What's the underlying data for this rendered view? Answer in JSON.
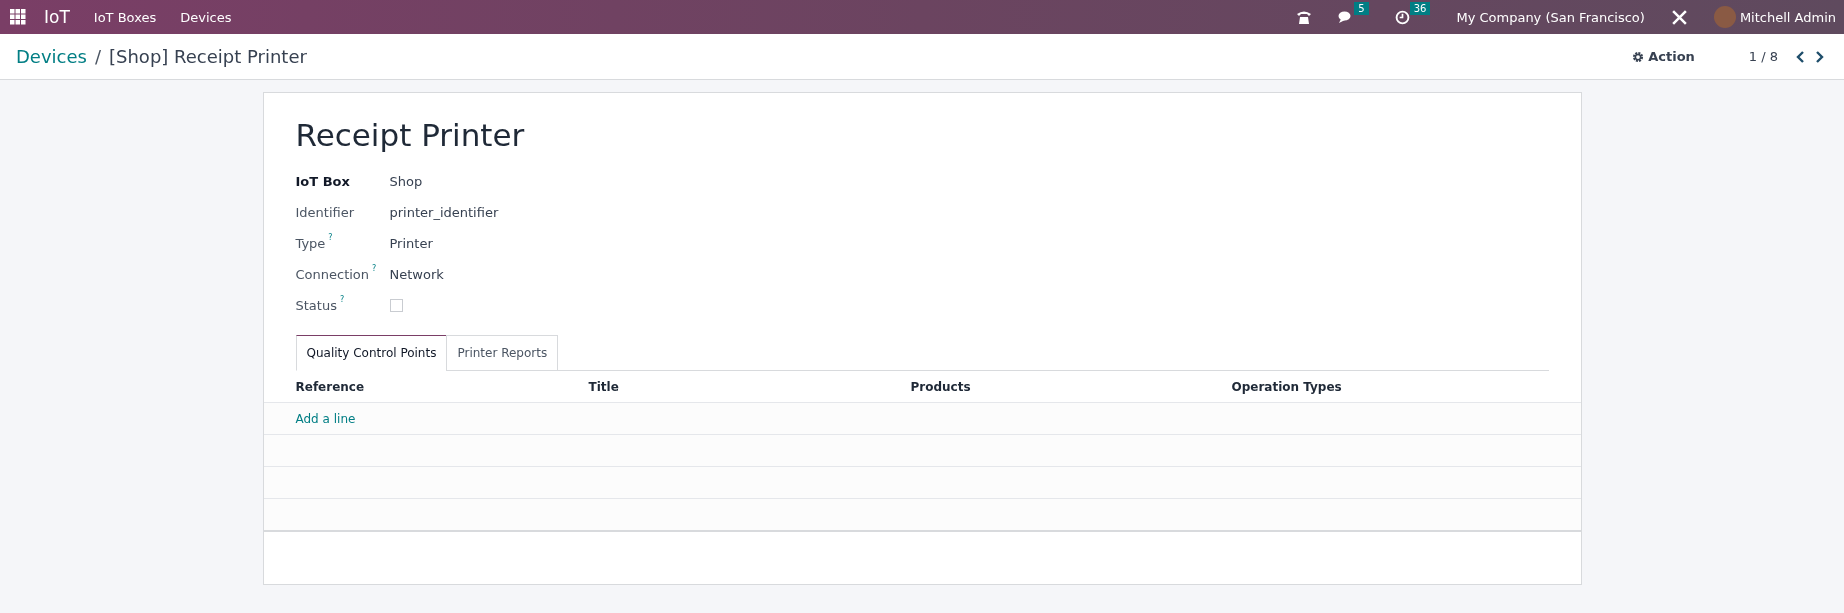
{
  "navbar": {
    "app_name": "IoT",
    "menu": [
      "IoT Boxes",
      "Devices"
    ],
    "messages_count": "5",
    "activities_count": "36",
    "company": "My Company (San Francisco)",
    "user": "Mitchell Admin"
  },
  "control_panel": {
    "breadcrumb": "Devices",
    "separator": "/",
    "current": "[Shop] Receipt Printer",
    "action": "Action",
    "pager": "1 / 8"
  },
  "form": {
    "title": "Receipt Printer",
    "fields": [
      {
        "label": "IoT Box",
        "kind": "text",
        "required": true,
        "value": "Shop"
      },
      {
        "label": "Identifier",
        "kind": "text",
        "required": false,
        "value": "printer_identifier"
      },
      {
        "label": "Type",
        "kind": "text",
        "required": false,
        "help": "?",
        "value": "Printer"
      },
      {
        "label": "Connection",
        "kind": "text",
        "required": false,
        "help": "?",
        "value": "Network"
      },
      {
        "label": "Status",
        "kind": "checkbox",
        "required": false,
        "help": "?",
        "checked": false
      }
    ],
    "tabs": [
      {
        "label": "Quality Control Points",
        "selected": true
      },
      {
        "label": "Printer Reports",
        "selected": false
      }
    ],
    "table": {
      "columns": [
        "Reference",
        "Title",
        "Products",
        "Operation Types"
      ],
      "add_line": "Add a line"
    }
  }
}
